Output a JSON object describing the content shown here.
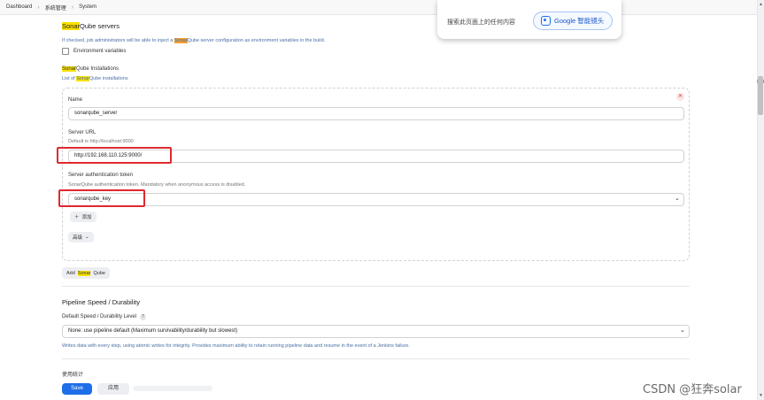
{
  "breadcrumb": [
    "Dashboard",
    "系统管理",
    "System"
  ],
  "popup": {
    "text": "搜索此页面上的任何内容",
    "button": "Google 智能镜头"
  },
  "sonarqube_servers": {
    "title_hl": "Sonar",
    "title_rest": "Qube servers",
    "desc_pre": "If checked, job administrators will be able to inject a ",
    "desc_hl": "Sonar",
    "desc_post": "Qube server configuration as environment variables in the build.",
    "env_checkbox_label": "Environment variables",
    "installations_hl": "Sonar",
    "installations_rest": "Qube Installations",
    "list_pre": "List of ",
    "list_hl": "Sonar",
    "list_post": "Qube installations"
  },
  "installation": {
    "name_label": "Name",
    "name_value": "sonarqube_server",
    "url_label": "Server URL",
    "url_default": "Default is http://localhost:9000",
    "url_value": "http://192.168.110.125:9000/",
    "token_label": "Server authentication token",
    "token_desc": "SonarQube authentication token. Mandatory when anonymous access is disabled.",
    "token_value": "sonarqube_key",
    "add_label": "添加",
    "advanced_label": "高级",
    "add_sonar_pre": "Add ",
    "add_sonar_hl": "Sonar",
    "add_sonar_post": "Qube"
  },
  "pipeline": {
    "title": "Pipeline Speed / Durability",
    "level_label": "Default Speed / Durability Level",
    "level_value": "None: use pipeline default (Maximum survivability/durability but slowest)",
    "level_desc": "Writes data with every step, using atomic writes for integrity.  Provides maximum ability to retain running pipeline data and resume in the event of a Jenkins failure.",
    "usage_title": "使用统计"
  },
  "footer": {
    "save": "Save",
    "apply": "应用"
  },
  "watermark": "CSDN @狂奔solar"
}
